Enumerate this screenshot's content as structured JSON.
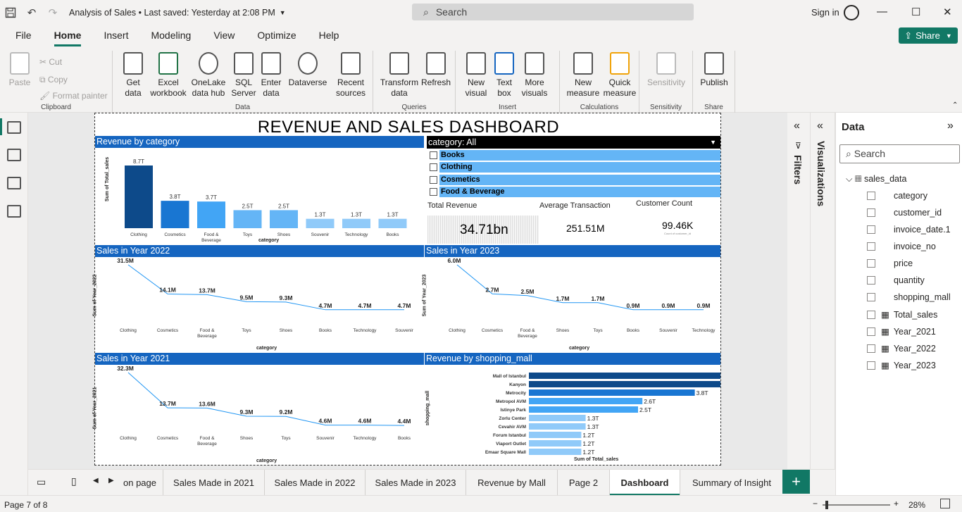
{
  "titlebar": {
    "title": "Analysis of Sales • Last saved: Yesterday at 2:08 PM",
    "search_placeholder": "Search",
    "signin": "Sign in"
  },
  "menu": [
    "File",
    "Home",
    "Insert",
    "Modeling",
    "View",
    "Optimize",
    "Help"
  ],
  "share_label": "Share",
  "ribbon": {
    "clipboard": {
      "paste": "Paste",
      "cut": "Cut",
      "copy": "Copy",
      "format_painter": "Format painter",
      "label": "Clipboard"
    },
    "data": {
      "get_data": "Get data",
      "excel": "Excel workbook",
      "onelake": "OneLake data hub",
      "sql": "SQL Server",
      "enter": "Enter data",
      "dataverse": "Dataverse",
      "recent": "Recent sources",
      "label": "Data"
    },
    "queries": {
      "transform": "Transform data",
      "refresh": "Refresh",
      "label": "Queries"
    },
    "insert": {
      "new_visual": "New visual",
      "text_box": "Text box",
      "more_visuals": "More visuals",
      "label": "Insert"
    },
    "calculations": {
      "new_measure": "New measure",
      "quick_measure": "Quick measure",
      "label": "Calculations"
    },
    "sensitivity": {
      "sensitivity": "Sensitivity",
      "label": "Sensitivity"
    },
    "share": {
      "publish": "Publish",
      "label": "Share"
    }
  },
  "report": {
    "title": "REVENUE AND SALES DASHBOARD",
    "rev_by_cat": {
      "title": "Revenue by category",
      "ylabel": "Sum of Total_sales",
      "xlabel": "category"
    },
    "slicer": {
      "header": "category: All",
      "items": [
        "Books",
        "Clothing",
        "Cosmetics",
        "Food & Beverage"
      ]
    },
    "cards": {
      "total_revenue_label": "Total Revenue",
      "total_revenue": "34.71bn",
      "avg_label": "Average Transaction",
      "avg": "251.51M",
      "cust_label": "Customer Count",
      "cust": "99.46K",
      "cust_sub": "Count of customer_id"
    },
    "s2022": {
      "title": "Sales in Year 2022",
      "ylabel": "Sum of Year_2022",
      "xlabel": "category"
    },
    "s2023": {
      "title": "Sales in Year 2023",
      "ylabel": "Sum of Year_2023",
      "xlabel": "category"
    },
    "s2021": {
      "title": "Sales in Year 2021",
      "ylabel": "Sum of Year_2021",
      "xlabel": "category"
    },
    "mall": {
      "title": "Revenue by shopping_mall",
      "ylabel": "shopping_mall",
      "xlabel": "Sum of Total_sales"
    }
  },
  "chart_data": [
    {
      "type": "bar",
      "title": "Revenue by category",
      "categories": [
        "Clothing",
        "Cosmetics",
        "Food & Beverage",
        "Toys",
        "Shoes",
        "Souvenir",
        "Technology",
        "Books"
      ],
      "values": [
        8.7,
        3.8,
        3.7,
        2.5,
        2.5,
        1.3,
        1.3,
        1.3
      ],
      "labels": [
        "8.7T",
        "3.8T",
        "3.7T",
        "2.5T",
        "2.5T",
        "1.3T",
        "1.3T",
        "1.3T"
      ],
      "xlabel": "category",
      "ylabel": "Sum of Total_sales"
    },
    {
      "type": "line",
      "title": "Sales in Year 2022",
      "categories": [
        "Clothing",
        "Cosmetics",
        "Food & Beverage",
        "Toys",
        "Shoes",
        "Books",
        "Technology",
        "Souvenir"
      ],
      "values": [
        31.5,
        14.1,
        13.7,
        9.5,
        9.3,
        4.7,
        4.7,
        4.7
      ],
      "labels": [
        "31.5M",
        "14.1M",
        "13.7M",
        "9.5M",
        "9.3M",
        "4.7M",
        "4.7M",
        "4.7M"
      ],
      "xlabel": "category",
      "ylabel": "Sum of Year_2022"
    },
    {
      "type": "line",
      "title": "Sales in Year 2023",
      "categories": [
        "Clothing",
        "Cosmetics",
        "Food & Beverage",
        "Shoes",
        "Toys",
        "Books",
        "Souvenir",
        "Technology"
      ],
      "values": [
        6.0,
        2.7,
        2.5,
        1.7,
        1.7,
        0.9,
        0.9,
        0.9
      ],
      "labels": [
        "6.0M",
        "2.7M",
        "2.5M",
        "1.7M",
        "1.7M",
        "0.9M",
        "0.9M",
        "0.9M"
      ],
      "xlabel": "category",
      "ylabel": "Sum of Year_2023"
    },
    {
      "type": "line",
      "title": "Sales in Year 2021",
      "categories": [
        "Clothing",
        "Cosmetics",
        "Food & Beverage",
        "Shoes",
        "Toys",
        "Souvenir",
        "Technology",
        "Books"
      ],
      "values": [
        32.3,
        13.7,
        13.6,
        9.3,
        9.2,
        4.6,
        4.6,
        4.4
      ],
      "labels": [
        "32.3M",
        "13.7M",
        "13.6M",
        "9.3M",
        "9.2M",
        "4.6M",
        "4.6M",
        "4.4M"
      ],
      "xlabel": "category",
      "ylabel": "Sum of Year_2021"
    },
    {
      "type": "bar",
      "orientation": "horizontal",
      "title": "Revenue by shopping_mall",
      "categories": [
        "Mall of Istanbul",
        "Kanyon",
        "Metrocity",
        "Metropol AVM",
        "Istinye Park",
        "Zorlu Center",
        "Cevahir AVM",
        "Forum Istanbul",
        "Viaport Outlet",
        "Emaar Square Mall"
      ],
      "values": [
        5.0,
        5.0,
        3.8,
        2.6,
        2.5,
        1.3,
        1.3,
        1.2,
        1.2,
        1.2
      ],
      "labels": [
        "5.0T",
        "5.0T",
        "3.8T",
        "2.6T",
        "2.5T",
        "1.3T",
        "1.3T",
        "1.2T",
        "1.2T",
        "1.2T"
      ],
      "xlabel": "Sum of Total_sales",
      "ylabel": "shopping_mall"
    }
  ],
  "panes": {
    "filters": "Filters",
    "visualizations": "Visualizations",
    "data_title": "Data",
    "data_search": "Search",
    "table": "sales_data",
    "fields": [
      "category",
      "customer_id",
      "invoice_date.1",
      "invoice_no",
      "price",
      "quantity",
      "shopping_mall",
      "Total_sales",
      "Year_2021",
      "Year_2022",
      "Year_2023"
    ]
  },
  "tabs": [
    "on page",
    "Sales Made in 2021",
    "Sales Made in 2022",
    "Sales Made in 2023",
    "Revenue by Mall",
    "Page 2",
    "Dashboard",
    "Summary of Insight"
  ],
  "status": {
    "page": "Page 7 of 8",
    "zoom": "28%"
  },
  "colors": {
    "accent": "#117865",
    "header": "#1565c0",
    "bar_dark": "#0d4a8a",
    "bar_mid": "#1976d2",
    "bar_light": "#64b5f6",
    "bar_pale": "#90caf9"
  }
}
